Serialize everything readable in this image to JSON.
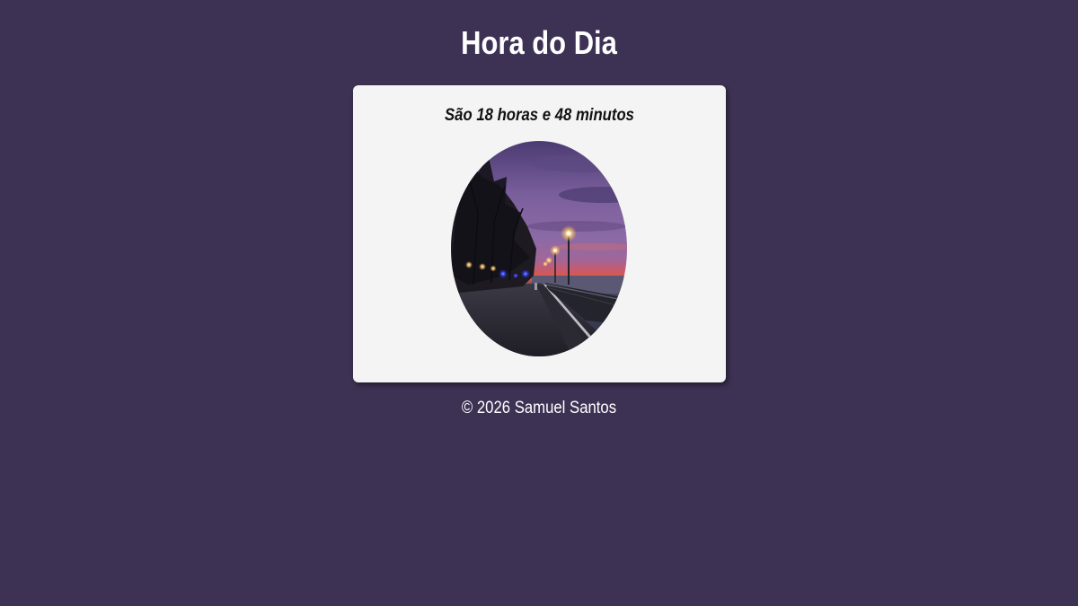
{
  "header": {
    "title": "Hora do Dia"
  },
  "card": {
    "message": "São 18 horas e 48 minutos",
    "image_subject": "evening-waterfront-promenade-photo"
  },
  "footer": {
    "copyright": "© 2026 Samuel Santos"
  },
  "colors": {
    "background": "#3e3254",
    "card": "#f4f4f4",
    "title_text": "#ffffff",
    "message_text": "#111111"
  }
}
